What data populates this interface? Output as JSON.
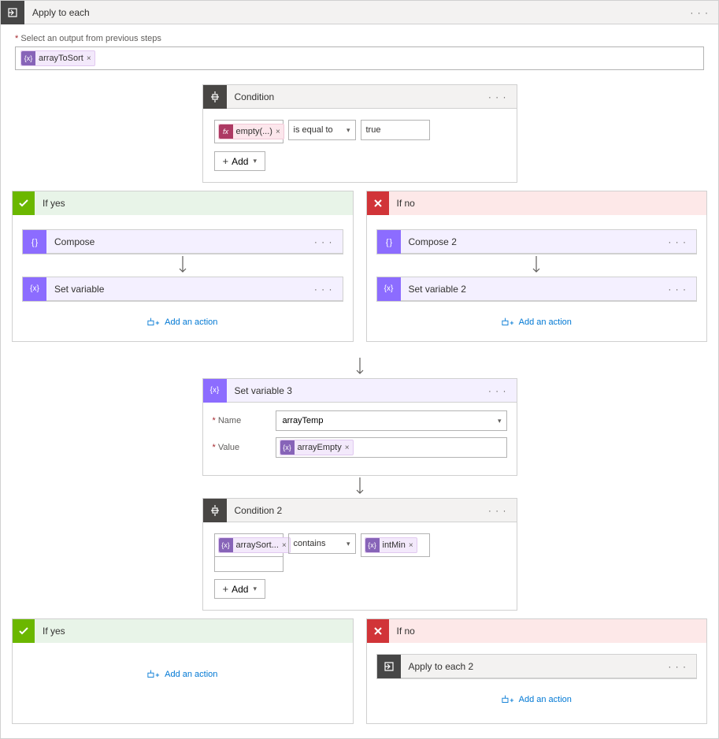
{
  "applyToEach": {
    "title": "Apply to each",
    "menuDots": "· · ·",
    "selectLabel": "Select an output from previous steps",
    "inputToken": "arrayToSort"
  },
  "condition1": {
    "title": "Condition",
    "menuDots": "· · ·",
    "leftToken": "empty(...)",
    "operator": "is equal to",
    "rightValue": "true",
    "addLabel": "Add"
  },
  "branch1Yes": {
    "title": "If yes",
    "compose": {
      "title": "Compose",
      "menuDots": "· · ·"
    },
    "setVar": {
      "title": "Set variable",
      "menuDots": "· · ·"
    },
    "addAction": "Add an action"
  },
  "branch1No": {
    "title": "If no",
    "compose": {
      "title": "Compose 2",
      "menuDots": "· · ·"
    },
    "setVar": {
      "title": "Set variable 2",
      "menuDots": "· · ·"
    },
    "addAction": "Add an action"
  },
  "setVar3": {
    "title": "Set variable 3",
    "menuDots": "· · ·",
    "nameLabel": "Name",
    "nameValue": "arrayTemp",
    "valueLabel": "Value",
    "valueToken": "arrayEmpty"
  },
  "condition2": {
    "title": "Condition 2",
    "menuDots": "· · ·",
    "leftToken": "arraySort...",
    "operator": "contains",
    "rightToken": "intMin",
    "addLabel": "Add"
  },
  "branch2Yes": {
    "title": "If yes",
    "addAction": "Add an action"
  },
  "branch2No": {
    "title": "If no",
    "applyToEach2": {
      "title": "Apply to each 2",
      "menuDots": "· · ·"
    },
    "addAction": "Add an action"
  }
}
